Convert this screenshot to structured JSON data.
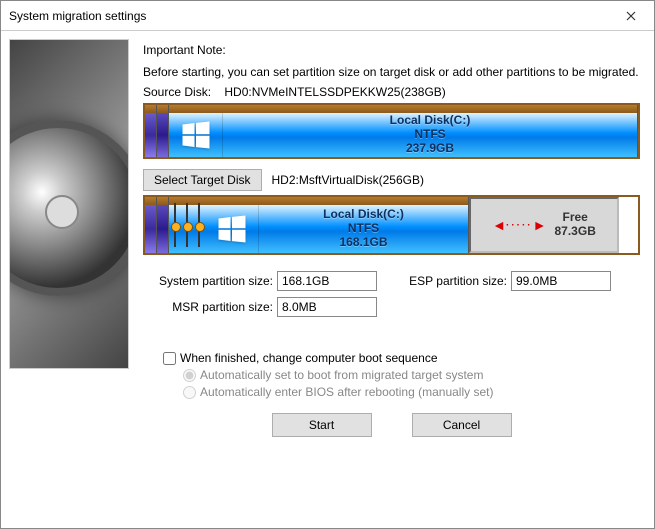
{
  "window": {
    "title": "System migration settings"
  },
  "header": {
    "important_note": "Important Note:",
    "before_starting": "Before starting, you can set partition size on target disk or add other partitions to be migrated.",
    "source_disk_label": "Source Disk:",
    "source_disk_value": "HD0:NVMeINTELSSDPEKKW25(238GB)"
  },
  "source_partition": {
    "name": "Local Disk(C:)",
    "fs": "NTFS",
    "size": "237.9GB"
  },
  "select_target_label": "Select Target Disk",
  "target_disk_value": "HD2:MsftVirtualDisk(256GB)",
  "target_partition": {
    "name": "Local Disk(C:)",
    "fs": "NTFS",
    "size": "168.1GB"
  },
  "free": {
    "label": "Free",
    "size": "87.3GB"
  },
  "form": {
    "system_label": "System partition size:",
    "system_value": "168.1GB",
    "esp_label": "ESP partition size:",
    "esp_value": "99.0MB",
    "msr_label": "MSR partition size:",
    "msr_value": "8.0MB"
  },
  "options": {
    "checkbox": "When finished, change computer boot sequence",
    "radio1": "Automatically set to boot from migrated target system",
    "radio2": "Automatically enter BIOS after rebooting (manually set)"
  },
  "buttons": {
    "start": "Start",
    "cancel": "Cancel"
  }
}
